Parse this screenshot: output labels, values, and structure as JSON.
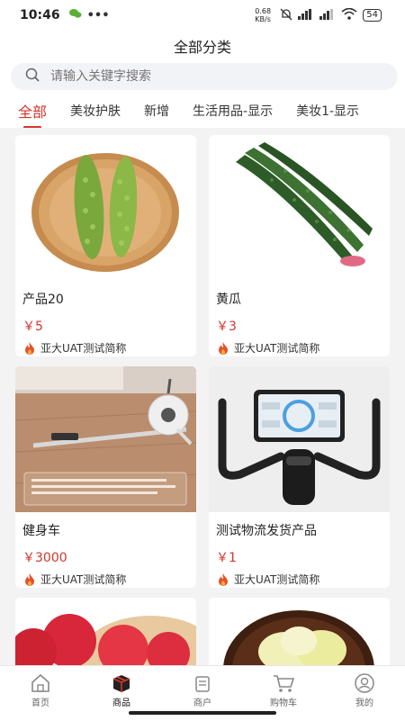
{
  "status": {
    "time": "10:46",
    "net_speed": "0.68 KB/s",
    "battery": "54"
  },
  "title": "全部分类",
  "search": {
    "placeholder": "请输入关键字搜索"
  },
  "tabs": [
    "全部",
    "美妆护肤",
    "新增",
    "生活用品-显示",
    "美妆1-显示"
  ],
  "products": [
    {
      "name": "产品20",
      "price": "￥5",
      "shop": "亚大UAT测试简称"
    },
    {
      "name": "黄瓜",
      "price": "￥3",
      "shop": "亚大UAT测试简称"
    },
    {
      "name": "健身车",
      "price": "￥3000",
      "shop": "亚大UAT测试简称"
    },
    {
      "name": "测试物流发货产品",
      "price": "￥1",
      "shop": "亚大UAT测试简称"
    }
  ],
  "nav": [
    {
      "label": "首页",
      "icon": "home-icon"
    },
    {
      "label": "商品",
      "icon": "box-icon"
    },
    {
      "label": "商户",
      "icon": "store-icon"
    },
    {
      "label": "购物车",
      "icon": "cart-icon"
    },
    {
      "label": "我的",
      "icon": "user-icon"
    }
  ],
  "colors": {
    "accent": "#d2362b"
  }
}
